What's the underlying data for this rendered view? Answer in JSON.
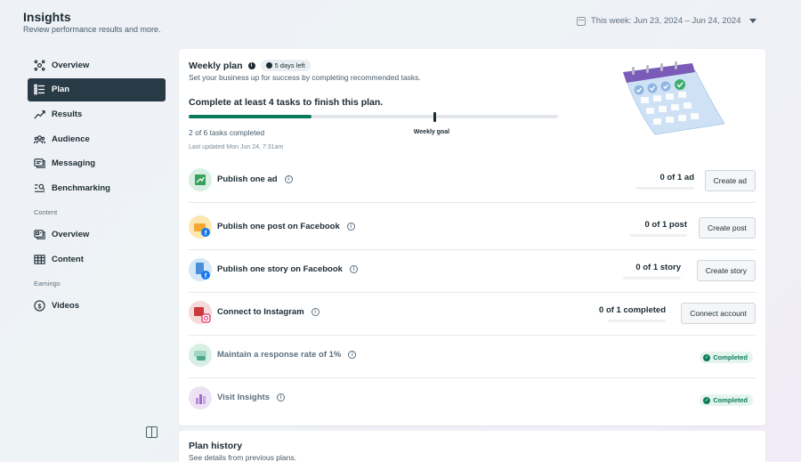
{
  "header": {
    "title": "Insights",
    "subtitle": "Review performance results and more.",
    "date_range": "This week: Jun 23, 2024 – Jun 24, 2024"
  },
  "sidebar": {
    "items": [
      {
        "label": "Overview",
        "icon": "overview-icon"
      },
      {
        "label": "Plan",
        "icon": "list-icon",
        "active": true
      },
      {
        "label": "Results",
        "icon": "chart-line-icon"
      },
      {
        "label": "Audience",
        "icon": "people-icon"
      },
      {
        "label": "Messaging",
        "icon": "messaging-icon"
      },
      {
        "label": "Benchmarking",
        "icon": "benchmark-icon"
      }
    ],
    "content_section": "Content",
    "content_items": [
      {
        "label": "Overview",
        "icon": "content-overview-icon"
      },
      {
        "label": "Content",
        "icon": "table-icon"
      }
    ],
    "earnings_section": "Earnings",
    "earnings_items": [
      {
        "label": "Videos",
        "icon": "dollar-icon"
      }
    ]
  },
  "plan": {
    "title": "Weekly plan",
    "days_left": "5 days left",
    "subtitle": "Set your business up for success by completing recommended tasks.",
    "goal_text": "Complete at least 4 tasks to finish this plan.",
    "progress_fraction": 0.333,
    "goal_fraction": 0.667,
    "goal_label": "Weekly goal",
    "completed_text": "2 of 6 tasks completed",
    "updated_text": "Last updated Mon Jun 24, 7:31am"
  },
  "tasks": [
    {
      "name": "Publish one ad",
      "count": "0 of 1 ad",
      "action": "Create ad",
      "icon": "ad-icon",
      "color": "#d8efe3"
    },
    {
      "name": "Publish one post on Facebook",
      "count": "0 of 1 post",
      "action": "Create post",
      "icon": "post-icon",
      "color": "#fbe7b3"
    },
    {
      "name": "Publish one story on Facebook",
      "count": "0 of 1 story",
      "action": "Create story",
      "icon": "story-icon",
      "color": "#d5e8f7"
    },
    {
      "name": "Connect to Instagram",
      "count": "0 of 1 completed",
      "action": "Connect account",
      "icon": "instagram-icon",
      "color": "#f6d9d9"
    },
    {
      "name": "Maintain a response rate of 1%",
      "status": "Completed",
      "icon": "response-icon",
      "color": "#d8efe6"
    },
    {
      "name": "Visit Insights",
      "status": "Completed",
      "icon": "insights-icon",
      "color": "#ece2f4"
    }
  ],
  "history": {
    "title": "Plan history",
    "subtitle": "See details from previous plans."
  },
  "colors": {
    "accent_green": "#0a7c5c",
    "sidebar_active": "#283a45"
  }
}
